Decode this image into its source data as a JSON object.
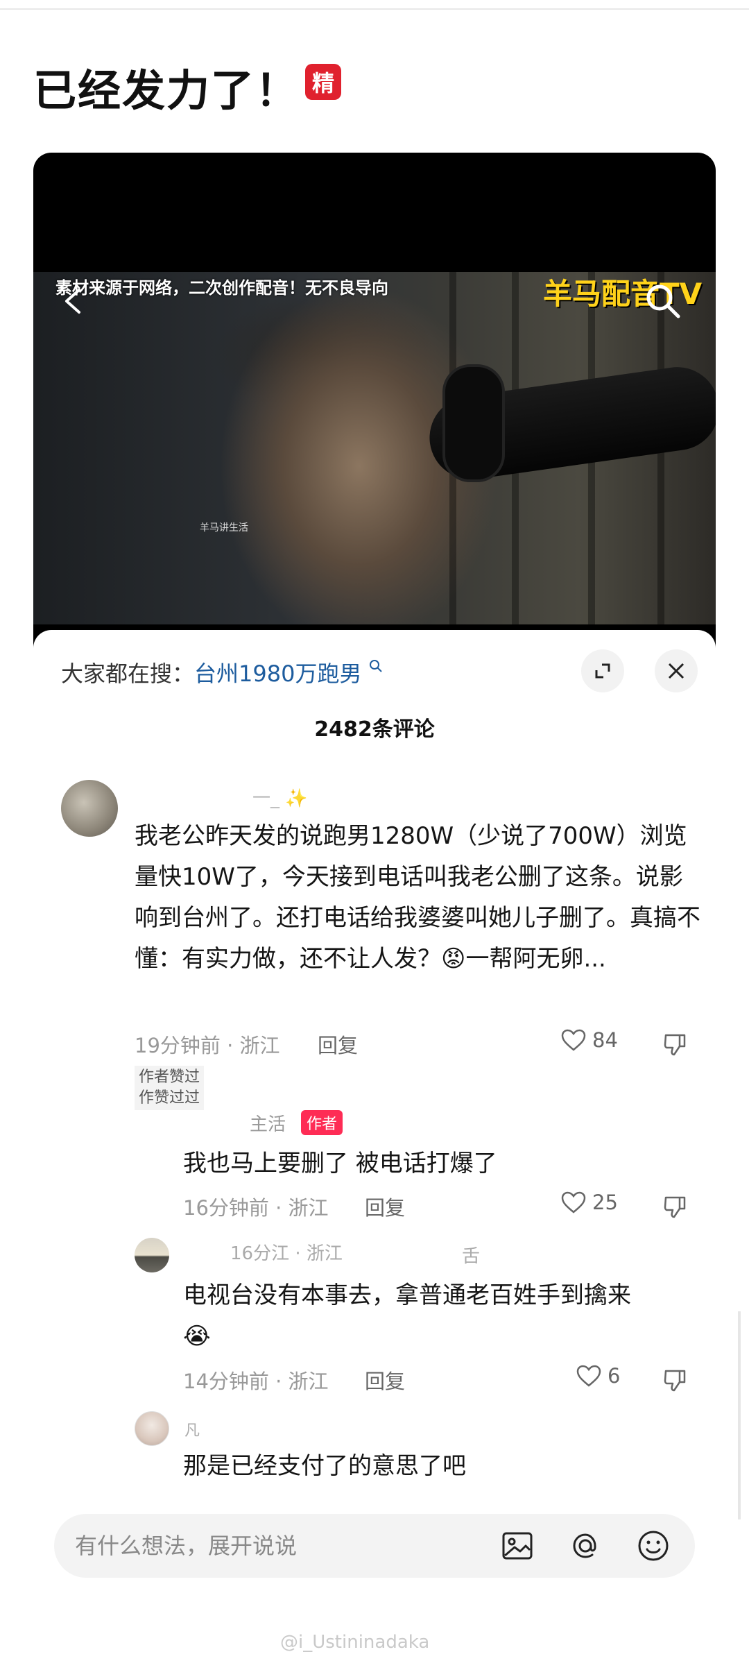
{
  "post": {
    "title": "已经发力了！",
    "badge": "精"
  },
  "video": {
    "subtitle": "素材来源于网络，二次创作配音！无不良导向",
    "watermark": "羊马配音TV",
    "small_caption": "羊马讲生活"
  },
  "sheet": {
    "trend_prefix": "大家都在搜：",
    "trend_term": "台州1980万跑男",
    "comment_count": "2482条评论"
  },
  "comments": [
    {
      "text": "我老公昨天发的说跑男1280W（少说了700W）浏览量快10W了，今天接到电话叫我老公删了这条。说影响到台州了。还打电话给我婆婆叫她儿子删了。真搞不懂：有实力做，还不让人发？😡一帮阿无卵...",
      "name_fragment": "一_ ✨",
      "meta": "19分钟前 · 浙江",
      "reply": "回复",
      "likes": "84",
      "liked_tag_1": "作者赞过",
      "liked_tag_2": "作赞过过"
    },
    {
      "name": "主活",
      "author_tag": "作者",
      "text": "我也马上要删了 被电话打爆了",
      "meta": "16分钟前 · 浙江",
      "reply": "回复",
      "likes": "25"
    },
    {
      "name_fragment": "16分江 · 浙江",
      "name_fragment_2": "舌",
      "text": "电视台没有本事去，拿普通老百姓手到擒来",
      "emoji": "😭",
      "meta": "14分钟前 · 浙江",
      "reply": "回复",
      "likes": "6"
    },
    {
      "name_fragment": "凡",
      "text": "那是已经支付了的意思了吧"
    }
  ],
  "input": {
    "placeholder": "有什么想法，展开说说"
  },
  "footer": {
    "watermark": "@i_Ustininadaka"
  },
  "colors": {
    "accent_red": "#fe2c55",
    "badge_red": "#e0212e",
    "link_blue": "#1d5c9e",
    "video_yellow": "#ffd21a"
  },
  "icons": [
    "back-icon",
    "search-icon",
    "expand-icon",
    "close-icon",
    "heart-icon",
    "dislike-icon",
    "image-icon",
    "at-icon",
    "emoji-icon"
  ]
}
